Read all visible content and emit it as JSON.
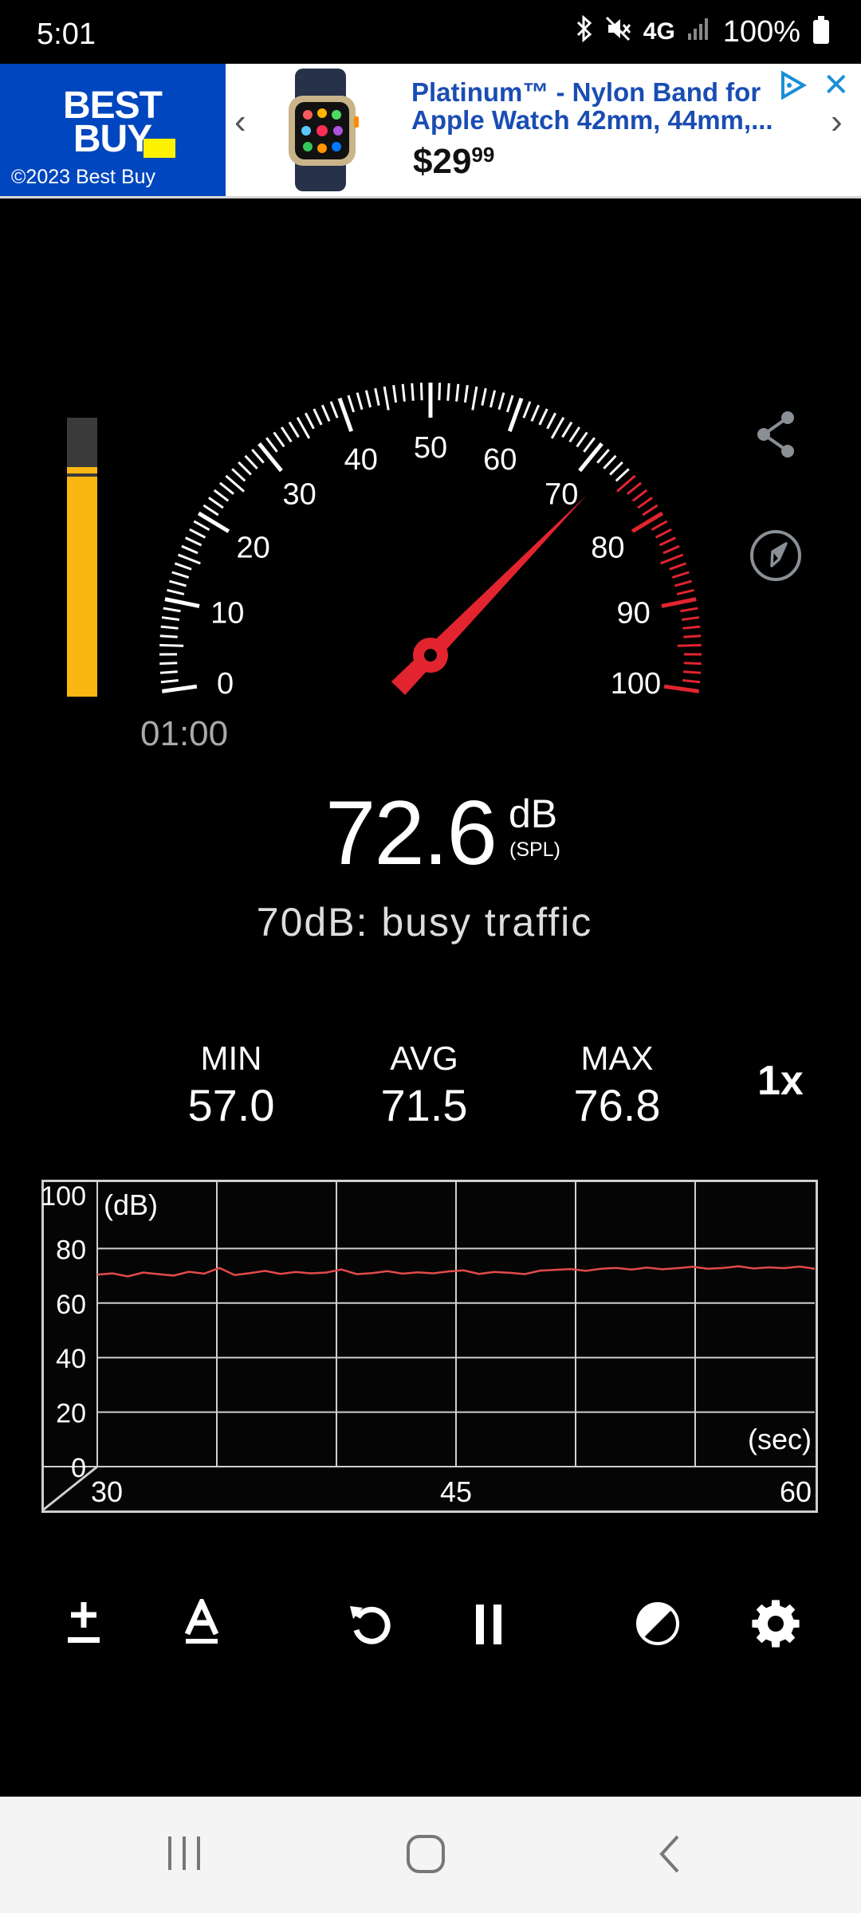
{
  "status_bar": {
    "time": "5:01",
    "network": "4G",
    "battery": "100%",
    "icons": [
      "bluetooth-icon",
      "mute-icon",
      "signal-icon",
      "battery-icon"
    ]
  },
  "ad": {
    "brand": "BEST BUY",
    "copyright": "©2023 Best Buy",
    "title": "Platinum™ - Nylon Band for Apple Watch 42mm, 44mm,...",
    "price_main": "$29",
    "price_cents": "99",
    "prev": "‹",
    "next": "›",
    "close": "✕",
    "colors": {
      "brand_blue": "#0046be",
      "tag_yellow": "#fff200",
      "title_blue": "#1a4db3"
    }
  },
  "meter": {
    "level_percent": 79,
    "peak_percent": 77,
    "timer": "01:00",
    "gauge": {
      "min": 0,
      "max": 100,
      "red_zone_start": 75,
      "needle_value": 72.6,
      "labels": [
        "0",
        "10",
        "20",
        "30",
        "40",
        "50",
        "60",
        "70",
        "80",
        "90",
        "100"
      ],
      "colors": {
        "needle": "#e2242f",
        "red_zone": "#e2242f",
        "ticks": "#ffffff"
      }
    },
    "reading": "72.6",
    "unit": "dB",
    "unit_sub": "(SPL)",
    "description": "70dB: busy traffic"
  },
  "stats": {
    "min_label": "MIN",
    "min_value": "57.0",
    "avg_label": "AVG",
    "avg_value": "71.5",
    "max_label": "MAX",
    "max_value": "76.8",
    "speed": "1x"
  },
  "chart_data": {
    "type": "line",
    "series": [
      {
        "values": [
          70.4,
          70.9,
          69.8,
          71.2,
          70.6,
          70.1,
          71.5,
          70.8,
          72.9,
          70.3,
          71.0,
          71.8,
          70.7,
          71.4,
          70.9,
          71.2,
          72.3,
          70.6,
          71.0,
          71.7,
          70.8,
          71.3,
          70.9,
          71.6,
          72.0,
          70.7,
          71.4,
          71.1,
          70.6,
          71.9,
          72.2,
          72.5,
          71.8,
          72.6,
          72.9,
          72.3,
          73.0,
          72.4,
          72.8,
          73.3,
          72.6,
          72.9,
          73.5,
          72.7,
          73.1,
          72.8,
          73.4,
          72.6
        ]
      }
    ],
    "x_start": 30,
    "x_end": 60,
    "xlim": [
      30,
      60
    ],
    "ylim": [
      0,
      100
    ],
    "y_ticks": [
      "0",
      "20",
      "40",
      "60",
      "80",
      "100"
    ],
    "x_ticks": [
      "30",
      "45",
      "60"
    ],
    "ylabel": "(dB)",
    "xlabel": "(sec)",
    "grid": true,
    "colors": {
      "line": "#e34a4a",
      "grid": "#cfcfcf"
    }
  },
  "toolbar": {
    "items": [
      "calibrate-icon",
      "weighting-a-icon",
      "reset-icon",
      "pause-icon",
      "theme-icon",
      "settings-icon"
    ]
  },
  "navbar": {
    "items": [
      "recent-apps-icon",
      "home-icon",
      "back-icon"
    ]
  }
}
